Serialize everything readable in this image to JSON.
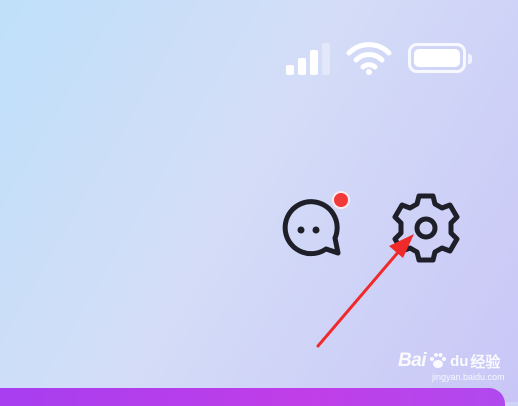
{
  "status_bar": {
    "icons": [
      "cellular-signal-icon",
      "wifi-icon",
      "battery-icon"
    ],
    "signal_bars_filled": 3,
    "signal_bars_total": 4,
    "battery_level": 1.0
  },
  "header_actions": {
    "messages": {
      "icon": "chat-bubble-icon",
      "has_notification_dot": true,
      "dot_color": "#f3383a"
    },
    "settings": {
      "icon": "gear-icon"
    }
  },
  "annotation": {
    "icon": "red-arrow-icon",
    "color": "#f02a2a"
  },
  "bottom_bar": {
    "color": "#b23ff0"
  },
  "watermark": {
    "brand": "Bai",
    "brand_suffix": "du",
    "text": "经验",
    "url": "jingyan.baidu.com"
  }
}
